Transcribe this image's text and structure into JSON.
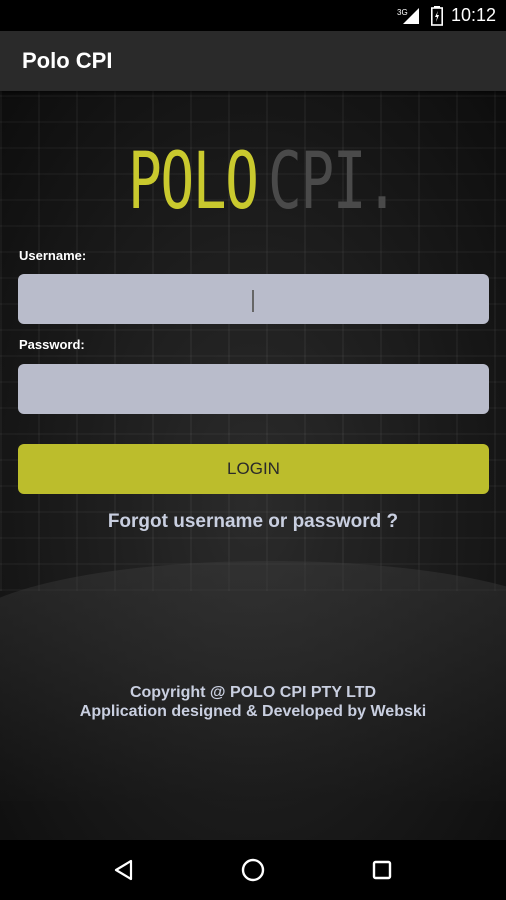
{
  "status_bar": {
    "network_label": "3G",
    "time": "10:12",
    "icons": [
      "signal-icon",
      "battery-icon"
    ]
  },
  "app_bar": {
    "title": "Polo CPI"
  },
  "logo": {
    "part1": "POLO",
    "part2": "CPI.",
    "part1_color": "#c9c92e",
    "part2_color": "#4a4a4a"
  },
  "form": {
    "username_label": "Username:",
    "username_value": "",
    "password_label": "Password:",
    "password_value": "",
    "login_label": "LOGIN",
    "forgot_label": "Forgot username or password ?"
  },
  "footer": {
    "line1": "Copyright @ POLO CPI PTY LTD",
    "line2": "Application designed & Developed by Webski"
  },
  "colors": {
    "accent": "#bcbd2c",
    "input_bg": "#b9bccb",
    "app_bar": "#2a2a2a"
  },
  "nav_bar": {
    "icons": [
      "back-icon",
      "home-icon",
      "recents-icon"
    ]
  }
}
